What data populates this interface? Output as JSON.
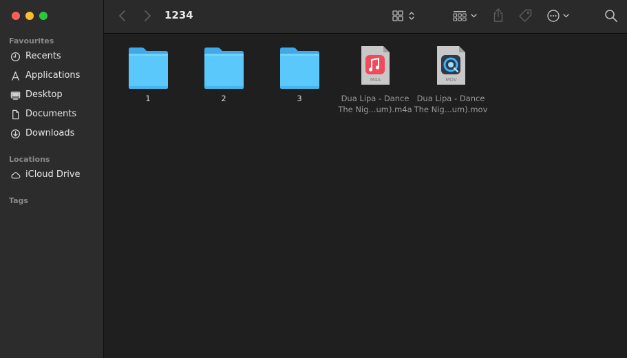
{
  "window": {
    "title": "1234"
  },
  "sidebar": {
    "favourites_title": "Favourites",
    "favourites": [
      {
        "label": "Recents",
        "icon": "clock-icon"
      },
      {
        "label": "Applications",
        "icon": "applications-icon"
      },
      {
        "label": "Desktop",
        "icon": "desktop-icon"
      },
      {
        "label": "Documents",
        "icon": "document-icon"
      },
      {
        "label": "Downloads",
        "icon": "download-icon"
      }
    ],
    "locations_title": "Locations",
    "locations": [
      {
        "label": "iCloud Drive",
        "icon": "cloud-icon"
      }
    ],
    "tags_title": "Tags"
  },
  "files": [
    {
      "name": "1",
      "kind": "folder"
    },
    {
      "name": "2",
      "kind": "folder"
    },
    {
      "name": "3",
      "kind": "folder"
    },
    {
      "name_line1": "Dua Lipa - Dance",
      "name_line2": "The Nig...um).m4a",
      "kind": "audio",
      "badge": "M4A"
    },
    {
      "name_line1": "Dua Lipa - Dance",
      "name_line2": "The Nig...um).mov",
      "kind": "video",
      "badge": "MOV"
    }
  ],
  "colors": {
    "folder": "#5ac8fa",
    "sidebar": "#2d2c2d",
    "content": "#1f1f1f",
    "toolbar": "#2a2a2a"
  }
}
